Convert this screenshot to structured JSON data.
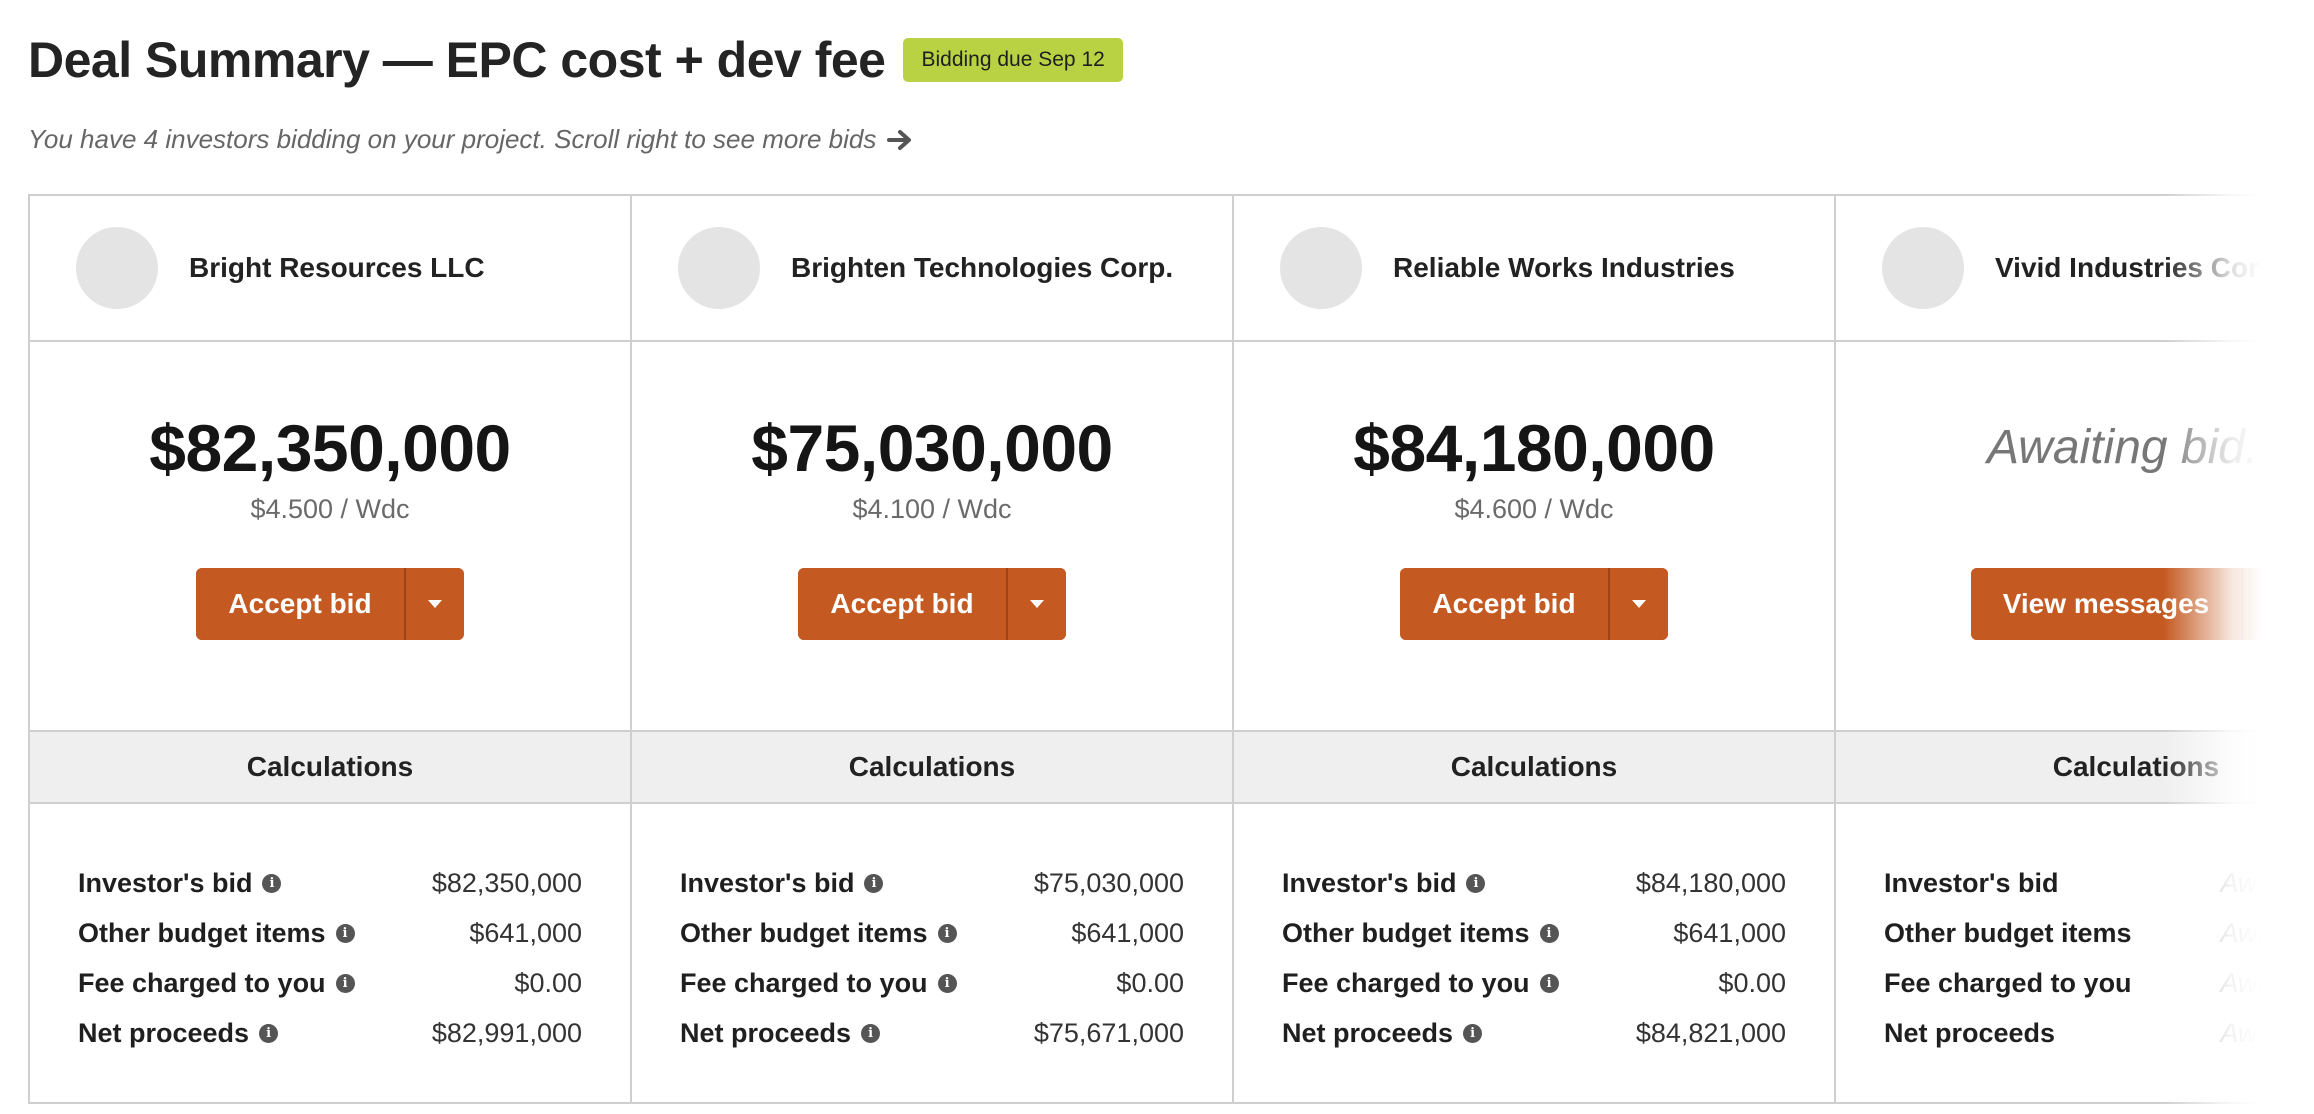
{
  "header": {
    "title": "Deal Summary — EPC cost + dev fee",
    "badge": "Bidding due Sep 12",
    "subtitle": "You have 4 investors bidding on your project. Scroll right to see more bids"
  },
  "calc_labels": {
    "heading": "Calculations",
    "investors_bid": "Investor's bid",
    "other_budget_items": "Other budget items",
    "fee_charged": "Fee charged to you",
    "net_proceeds": "Net proceeds"
  },
  "bids": [
    {
      "investor": "Bright Resources LLC",
      "amount": "$82,350,000",
      "per_wdc": "$4.500 / Wdc",
      "button": "Accept bid",
      "investors_bid": "$82,350,000",
      "other_budget_items": "$641,000",
      "fee_charged": "$0.00",
      "net_proceeds": "$82,991,000"
    },
    {
      "investor": "Brighten Technologies Corp.",
      "amount": "$75,030,000",
      "per_wdc": "$4.100 / Wdc",
      "button": "Accept bid",
      "investors_bid": "$75,030,000",
      "other_budget_items": "$641,000",
      "fee_charged": "$0.00",
      "net_proceeds": "$75,671,000"
    },
    {
      "investor": "Reliable Works Industries",
      "amount": "$84,180,000",
      "per_wdc": "$4.600 / Wdc",
      "button": "Accept bid",
      "investors_bid": "$84,180,000",
      "other_budget_items": "$641,000",
      "fee_charged": "$0.00",
      "net_proceeds": "$84,821,000"
    },
    {
      "investor": "Vivid Industries Corp.",
      "amount": "Awaiting bid...",
      "per_wdc": "",
      "button": "View messages",
      "investors_bid": "Awaiting bid...",
      "other_budget_items": "Awaiting bid...",
      "fee_charged": "Awaiting bid...",
      "net_proceeds": "Awaiting bid..."
    }
  ],
  "colors": {
    "accent": "#c45a21",
    "badge": "#b8d243"
  }
}
